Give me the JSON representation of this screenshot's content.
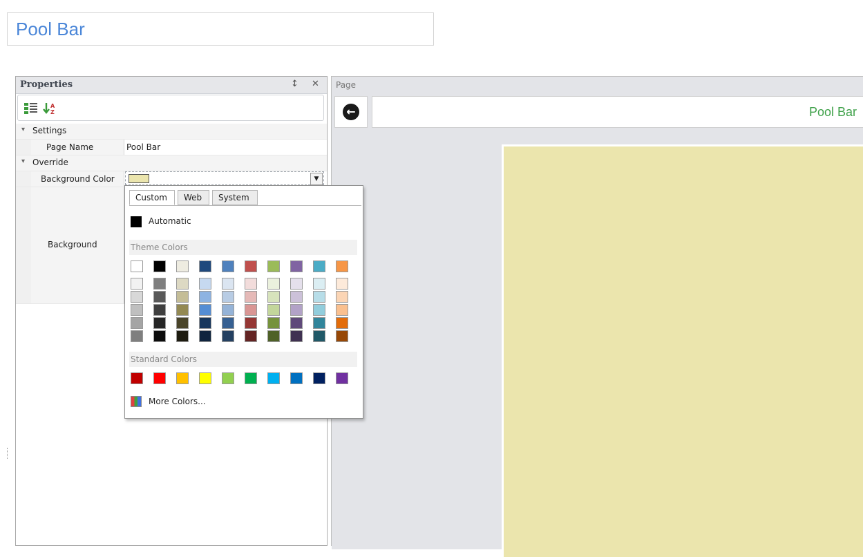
{
  "header": {
    "title": "Pool Bar"
  },
  "properties": {
    "panel_title": "Properties",
    "pin_icon": "pin-icon",
    "close_icon": "close-icon",
    "categories": [
      {
        "label": "Settings",
        "items": [
          {
            "name": "Page Name",
            "value": "Pool Bar"
          }
        ]
      },
      {
        "label": "Override",
        "items": [
          {
            "name": "Background Color",
            "value_color": "#ebe5ad"
          },
          {
            "name": "Background",
            "value": ""
          }
        ]
      }
    ]
  },
  "page": {
    "panel_label": "Page",
    "name": "Pool Bar",
    "background_color": "#ebe5ad"
  },
  "color_picker": {
    "tabs": [
      "Custom",
      "Web",
      "System"
    ],
    "active_tab": "Custom",
    "automatic_label": "Automatic",
    "theme_header": "Theme Colors",
    "standard_header": "Standard Colors",
    "more_label": "More Colors...",
    "theme_top": [
      "#ffffff",
      "#000000",
      "#eeece1",
      "#1f497d",
      "#4f81bd",
      "#c0504d",
      "#9bbb59",
      "#8064a2",
      "#4bacc6",
      "#f79646"
    ],
    "theme_shades": [
      [
        "#f2f2f2",
        "#d8d8d8",
        "#bfbfbf",
        "#a5a5a5",
        "#7f7f7f"
      ],
      [
        "#7f7f7f",
        "#595959",
        "#3f3f3f",
        "#262626",
        "#0c0c0c"
      ],
      [
        "#ddd9c3",
        "#c4bd97",
        "#938953",
        "#494429",
        "#1d1b10"
      ],
      [
        "#c6d9f0",
        "#8db3e2",
        "#548dd4",
        "#17365d",
        "#0f243e"
      ],
      [
        "#dbe5f1",
        "#b8cce4",
        "#95b3d7",
        "#366092",
        "#244061"
      ],
      [
        "#f2dcdb",
        "#e5b9b7",
        "#d99694",
        "#953734",
        "#632423"
      ],
      [
        "#ebf1dd",
        "#d7e3bc",
        "#c3d69b",
        "#76923c",
        "#4f6128"
      ],
      [
        "#e5e0ec",
        "#ccc1d9",
        "#b2a2c7",
        "#5f497a",
        "#3f3151"
      ],
      [
        "#dbeef3",
        "#b7dde8",
        "#92cddc",
        "#31859b",
        "#205867"
      ],
      [
        "#fdeada",
        "#fbd5b5",
        "#fac08f",
        "#e36c09",
        "#974806"
      ]
    ],
    "standard": [
      "#c00000",
      "#ff0000",
      "#ffc000",
      "#ffff00",
      "#92d050",
      "#00b050",
      "#00b0f0",
      "#0070c0",
      "#002060",
      "#7030a0"
    ]
  }
}
